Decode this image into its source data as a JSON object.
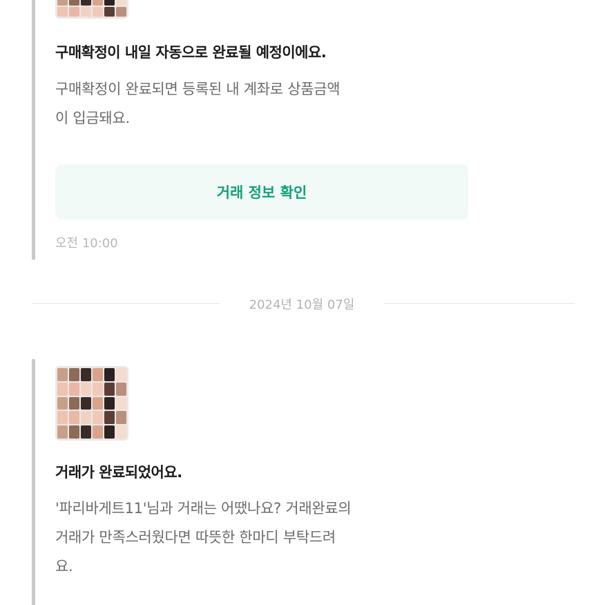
{
  "messages": [
    {
      "title": "구매확정이 내일 자동으로 완료될 예정이에요.",
      "body_lines": [
        "구매확정이 완료되면 등록된 내 계좌로 상품금액",
        "이 입금돼요."
      ],
      "button_label": "거래 정보 확인",
      "time": "오전 10:00"
    },
    {
      "title": "거래가 완료되었어요.",
      "body_lines": [
        "'파리바게트11'님과 거래는 어땠나요? 거래완료의",
        " 거래가 만족스러웠다면 따뜻한 한마디 부탁드려",
        "요."
      ]
    }
  ],
  "date_separator": "2024년 10월 07일",
  "colors": {
    "accent_green": "#13a077",
    "button_bg": "#f1faf7",
    "card_border": "#c9c9c9",
    "divider": "#e4e4e4"
  }
}
